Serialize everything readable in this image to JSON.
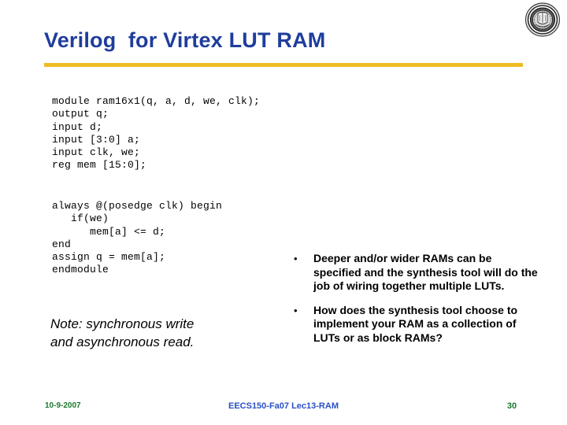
{
  "slide": {
    "title": "Verilog  for Virtex LUT RAM",
    "title_color": "#1F3D9C",
    "rule_color": "#EFBB24",
    "background_color": "#FFFFFF"
  },
  "logo": {
    "name": "university-seal",
    "alt": "university seal"
  },
  "code": {
    "block1": "module ram16x1(q, a, d, we, clk);\noutput q;\ninput d;\ninput [3:0] a;\ninput clk, we;\nreg mem [15:0];",
    "block2": "always @(posedge clk) begin\n   if(we)\n      mem[a] <= d;\nend\nassign q = mem[a];\nendmodule"
  },
  "note": {
    "text": "Note: synchronous write\nand asynchronous read."
  },
  "bullets": {
    "marker": "•",
    "items": [
      {
        "text": "Deeper and/or wider RAMs can be specified and the synthesis tool will do the job of wiring together multiple LUTs."
      },
      {
        "text": "How does the synthesis tool choose to implement your RAM as a collection of LUTs or as block RAMs?"
      }
    ]
  },
  "footer": {
    "date": "10-9-2007",
    "date_color": "#1A7A2E",
    "center": "EECS150-Fa07 Lec13-RAM",
    "center_color": "#2A4FC4",
    "page": "30",
    "page_color": "#1A7A2E"
  }
}
